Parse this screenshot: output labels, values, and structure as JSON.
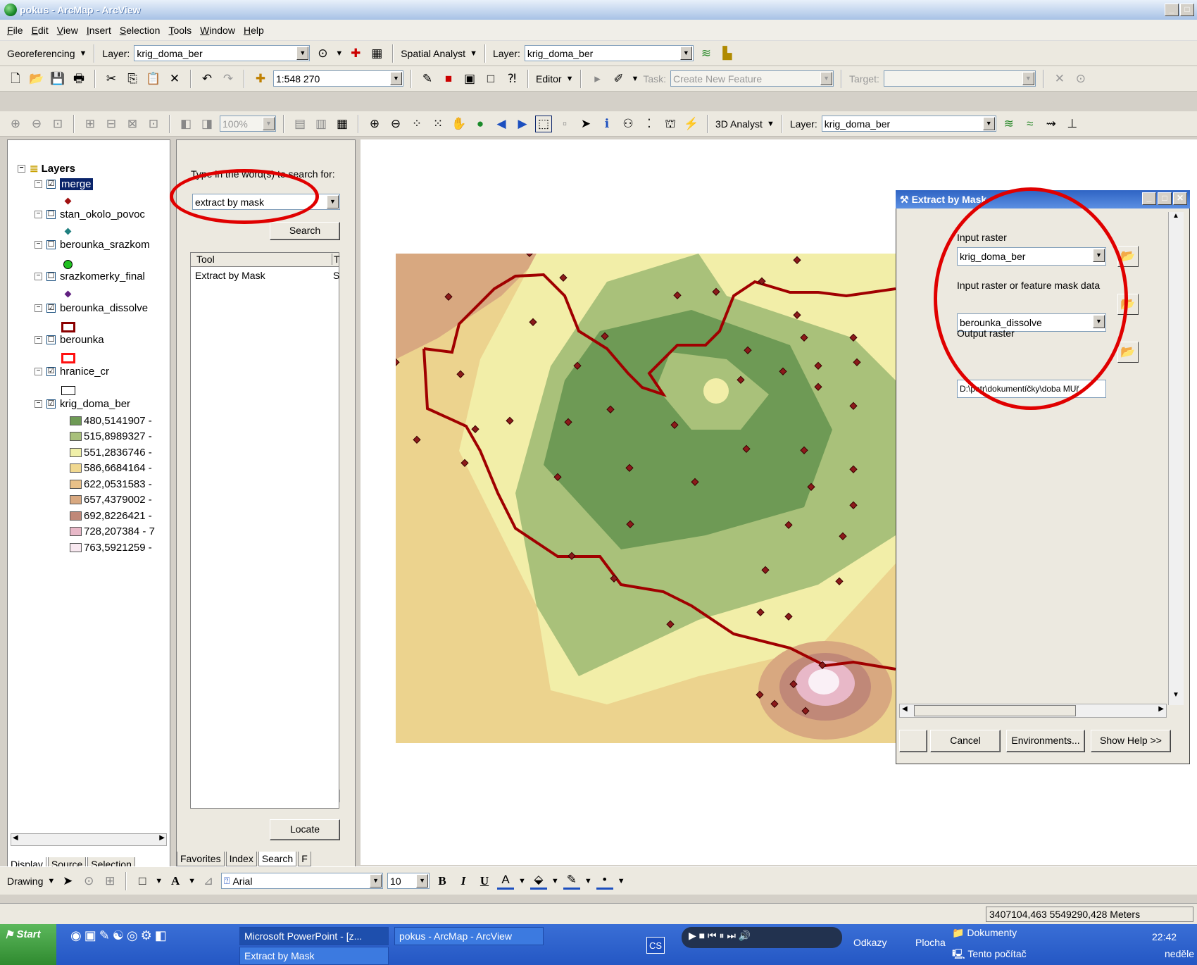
{
  "window": {
    "title": "pokus - ArcMap - ArcView",
    "controls": [
      "_",
      "□",
      "✕"
    ]
  },
  "menu": [
    "File",
    "Edit",
    "View",
    "Insert",
    "Selection",
    "Tools",
    "Window",
    "Help"
  ],
  "toolbar1": {
    "georeferencing": "Georeferencing",
    "layer_label": "Layer:",
    "layer_value": "krig_doma_ber",
    "spatial_analyst": "Spatial Analyst",
    "layer_label2": "Layer:",
    "layer_value2": "krig_doma_ber"
  },
  "toolbar2": {
    "scale": "1:548 270",
    "editor": "Editor",
    "task_label": "Task:",
    "task_value": "Create New Feature",
    "target_label": "Target:"
  },
  "toolbar3": {
    "zoom": "100%",
    "analyst3d": "3D Analyst",
    "layer_label": "Layer:",
    "layer_value": "krig_doma_ber"
  },
  "toc": {
    "root": "Layers",
    "layers": [
      {
        "name": "merge",
        "checked": "☑"
      },
      {
        "name": "stan_okolo_povoc",
        "checked": "☐"
      },
      {
        "name": "berounka_srazkom",
        "checked": "☐"
      },
      {
        "name": "srazkomerky_final",
        "checked": "☐"
      },
      {
        "name": "berounka_dissolve",
        "checked": "☑"
      },
      {
        "name": "berounka",
        "checked": "☐"
      },
      {
        "name": "hranice_cr",
        "checked": "☑"
      },
      {
        "name": "krig_doma_ber",
        "checked": "☑"
      }
    ],
    "legend": [
      {
        "label": "480,5141907 -",
        "color": "#6e9a55"
      },
      {
        "label": "515,8989327 -",
        "color": "#a8c07a"
      },
      {
        "label": "551,2836746 -",
        "color": "#f0f0a8"
      },
      {
        "label": "586,6684164 -",
        "color": "#f0d890"
      },
      {
        "label": "622,0531583 -",
        "color": "#e8c088"
      },
      {
        "label": "657,4379002 -",
        "color": "#d8a880"
      },
      {
        "label": "692,8226421 -",
        "color": "#c08878"
      },
      {
        "label": "728,207384 - 7",
        "color": "#e8b8c8"
      },
      {
        "label": "763,5921259 -",
        "color": "#f8e8f0"
      }
    ],
    "tabs": [
      "Display",
      "Source",
      "Selection"
    ]
  },
  "search": {
    "prompt": "Type in the word(s) to search for:",
    "query": "extract by mask",
    "search_btn": "Search",
    "col_tool": "Tool",
    "col_t": "T",
    "result": "Extract by Mask",
    "result_t": "S",
    "locate_btn": "Locate",
    "tabs": [
      "Favorites",
      "Index",
      "Search",
      "F"
    ]
  },
  "dialog": {
    "title": "Extract by Mask",
    "input_raster_label": "Input raster",
    "input_raster": "krig_doma_ber",
    "mask_label": "Input raster or feature mask data",
    "mask": "berounka_dissolve",
    "output_label": "Output raster",
    "output": "D:\\petr\\dokumentíčky\\doba MUř",
    "cancel": "Cancel",
    "environments": "Environments...",
    "show_help": "Show Help >>"
  },
  "drawbar": {
    "drawing": "Drawing",
    "font": "Arial",
    "size": "10",
    "bold": "B",
    "italic": "I",
    "underline": "U"
  },
  "status": {
    "coords": "3407104,463  5549290,428 Meters"
  },
  "taskbar": {
    "start": "Start",
    "items": [
      "Microsoft PowerPoint - [z...",
      "pokus - ArcMap - ArcView",
      "Extract by Mask"
    ],
    "lang": "CS",
    "odkazy": "Odkazy",
    "plocha": "Plocha",
    "dokumenty": "Dokumenty",
    "tento_pocitac": "Tento počítač",
    "time": "22:42",
    "day": "neděle"
  }
}
